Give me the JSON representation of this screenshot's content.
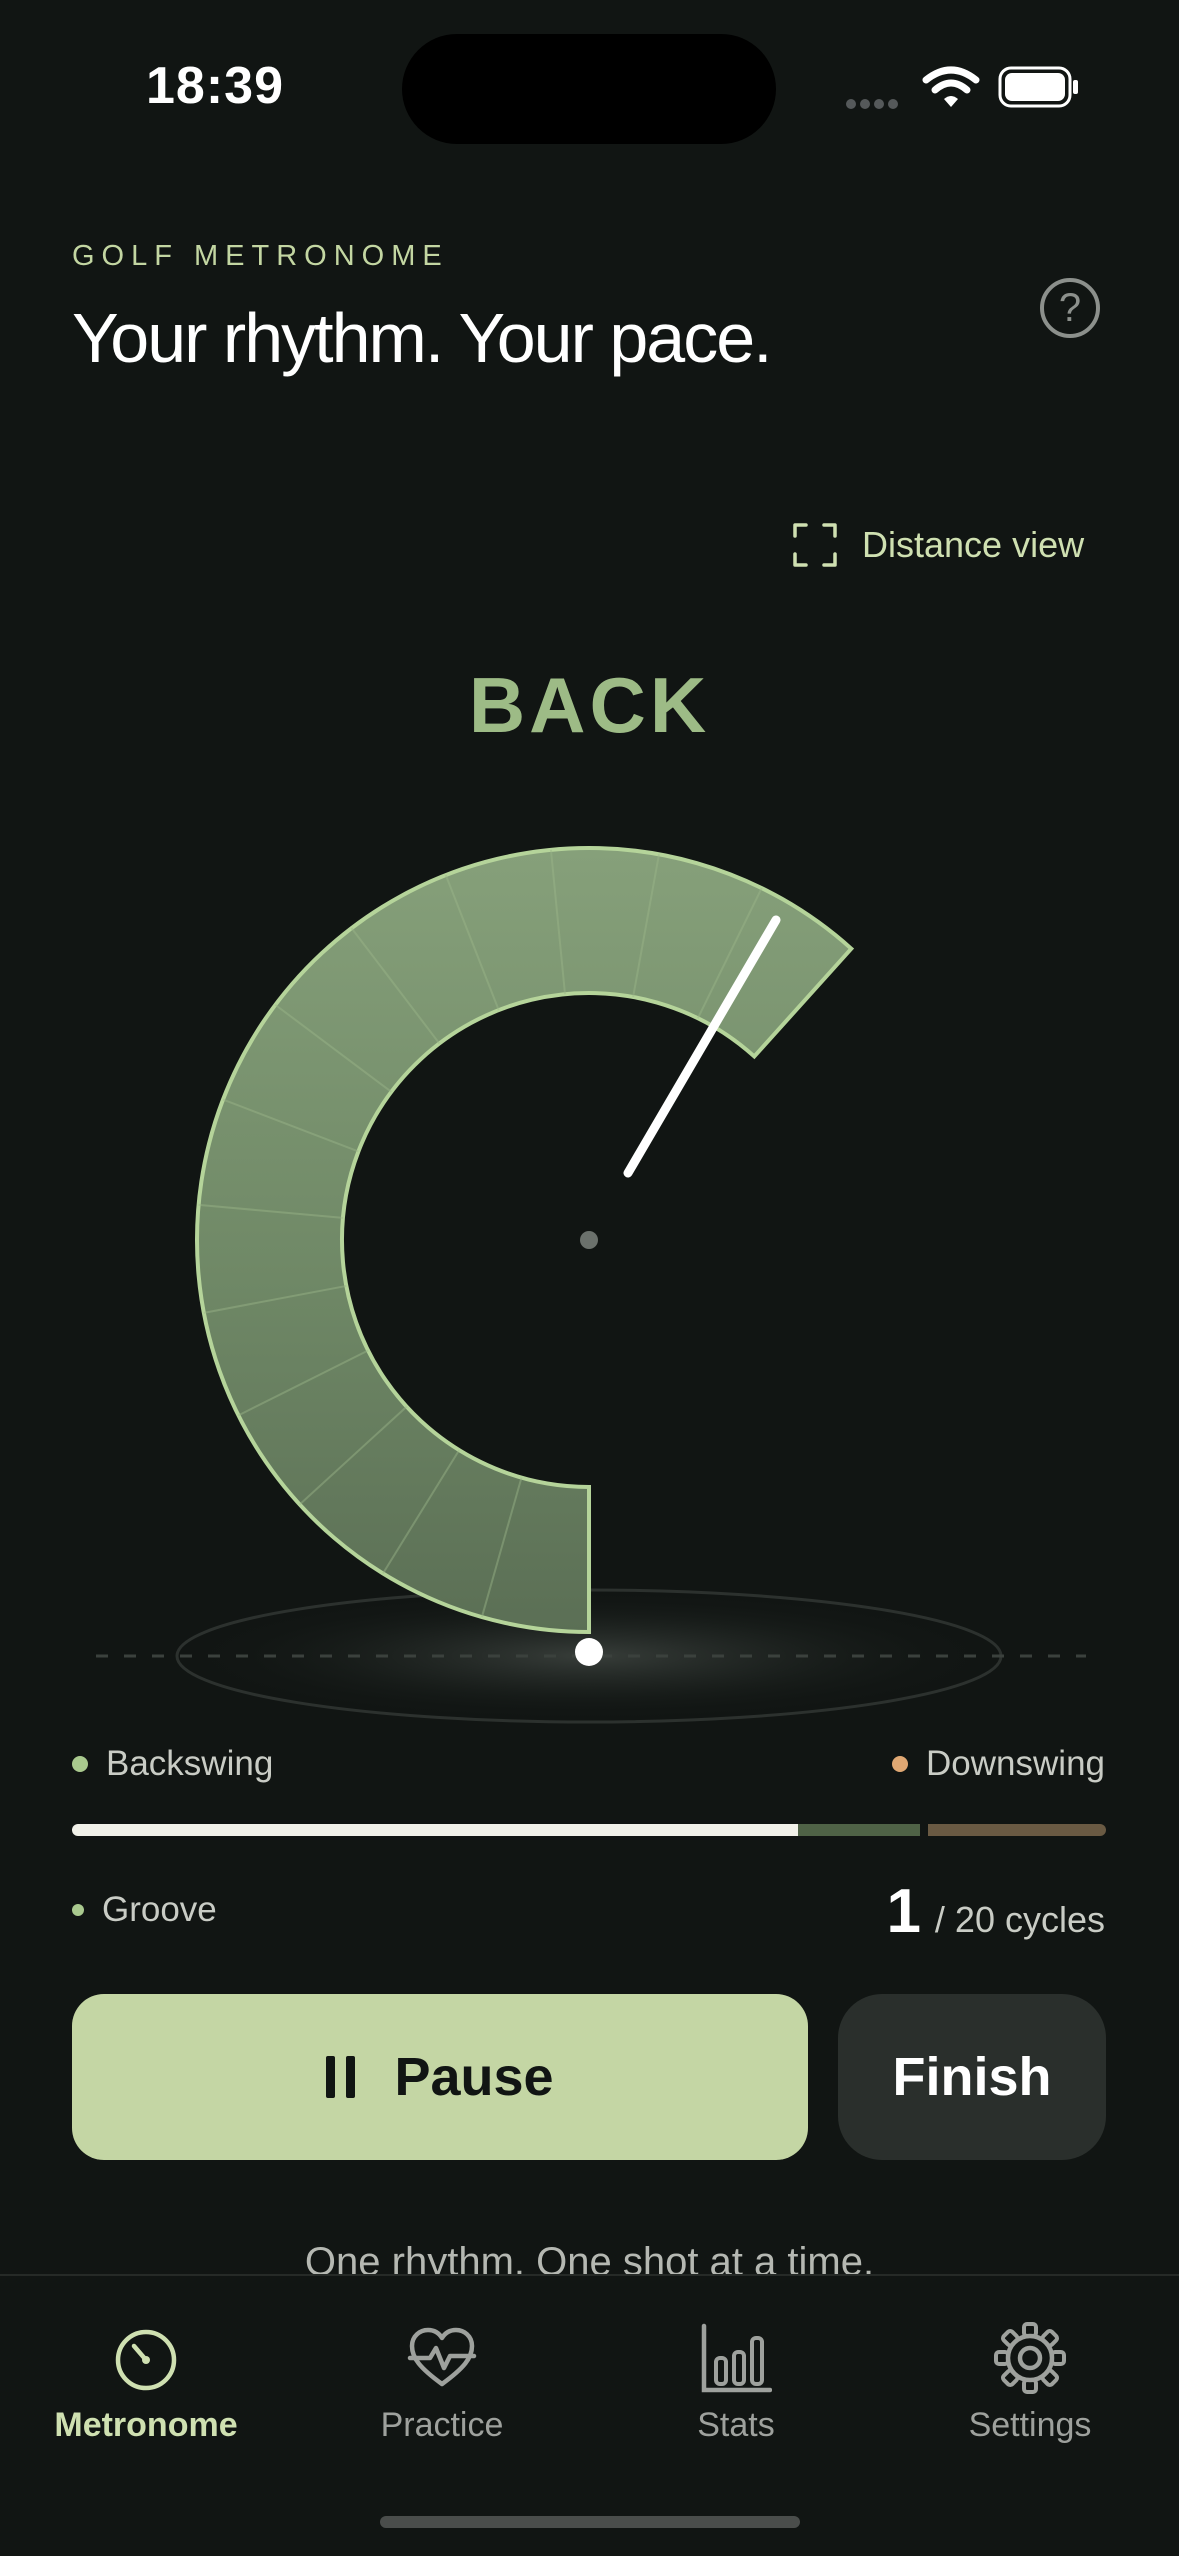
{
  "status_bar": {
    "time": "18:39"
  },
  "header": {
    "eyebrow": "GOLF METRONOME",
    "title": "Your rhythm. Your pace.",
    "help_label": "?"
  },
  "distance_view": {
    "label": "Distance view"
  },
  "phase": {
    "label": "BACK"
  },
  "swing": {
    "backswing_progress": 0.7,
    "backswing_color": "#a9c98e",
    "downswing_color": "#e0a873"
  },
  "legend": {
    "backswing": "Backswing",
    "downswing": "Downswing",
    "groove": "Groove"
  },
  "cycles": {
    "current": "1",
    "total_label": "/ 20 cycles"
  },
  "actions": {
    "pause_label": "Pause",
    "finish_label": "Finish"
  },
  "tagline": "One rhythm. One shot at a time.",
  "tabs": [
    {
      "label": "Metronome",
      "icon": "metronome-icon",
      "active": true
    },
    {
      "label": "Practice",
      "icon": "heart-pulse-icon",
      "active": false
    },
    {
      "label": "Stats",
      "icon": "bar-chart-icon",
      "active": false
    },
    {
      "label": "Settings",
      "icon": "gear-icon",
      "active": false
    }
  ],
  "colors": {
    "accent": "#c4d6a4",
    "background": "#111513",
    "phase_text": "#9dbb86"
  }
}
